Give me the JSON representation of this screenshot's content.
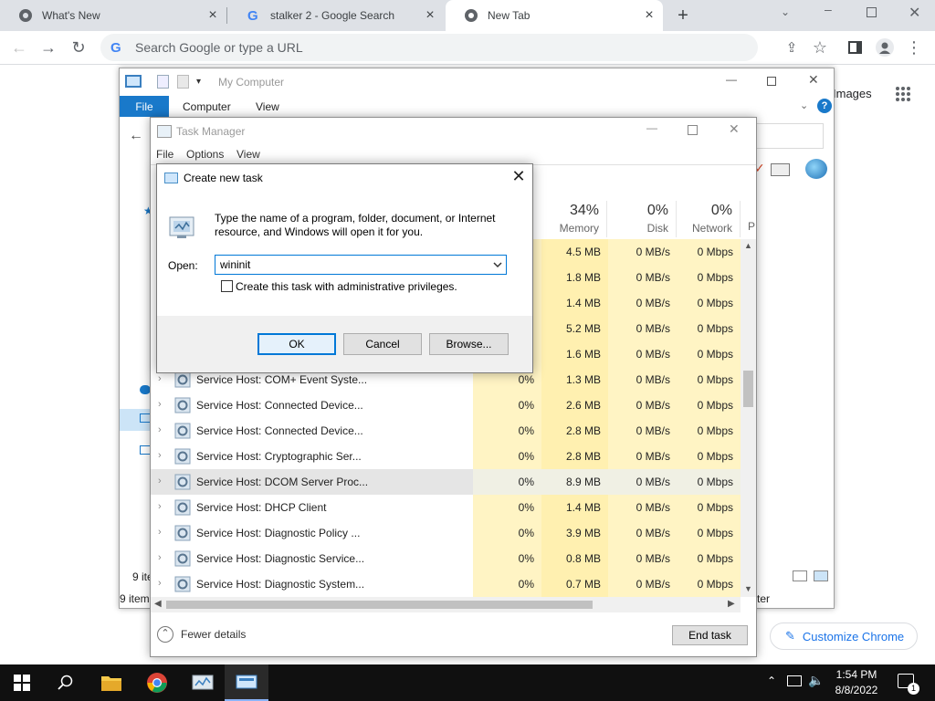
{
  "chrome": {
    "tabs": [
      {
        "title": "What's New"
      },
      {
        "title": "stalker 2 - Google Search"
      },
      {
        "title": "New Tab"
      }
    ],
    "omnibox_placeholder": "Search Google or type a URL",
    "ntp_images_link": "Images",
    "customize_label": "Customize Chrome"
  },
  "explorer": {
    "title": "My Computer",
    "ribbon": {
      "file": "File",
      "computer": "Computer",
      "view": "View"
    },
    "status_items_partial": "9 ite",
    "status_items": "9 item",
    "status_right": "ter"
  },
  "taskmgr": {
    "title": "Task Manager",
    "menu": {
      "file": "File",
      "options": "Options",
      "view": "View"
    },
    "columns": {
      "memory": {
        "pct": "34%",
        "label": "Memory"
      },
      "disk": {
        "pct": "0%",
        "label": "Disk"
      },
      "network": {
        "pct": "0%",
        "label": "Network"
      },
      "power_partial": "P"
    },
    "hidden_rows": [
      {
        "mem": "4.5 MB",
        "disk": "0 MB/s",
        "net": "0 Mbps"
      },
      {
        "mem": "1.8 MB",
        "disk": "0 MB/s",
        "net": "0 Mbps"
      },
      {
        "mem": "1.4 MB",
        "disk": "0 MB/s",
        "net": "0 Mbps"
      },
      {
        "mem": "5.2 MB",
        "disk": "0 MB/s",
        "net": "0 Mbps"
      },
      {
        "mem": "1.6 MB",
        "disk": "0 MB/s",
        "net": "0 Mbps"
      }
    ],
    "rows": [
      {
        "name": "Service Host: COM+ Event Syste...",
        "cpu": "0%",
        "mem": "1.3 MB",
        "disk": "0 MB/s",
        "net": "0 Mbps"
      },
      {
        "name": "Service Host: Connected Device...",
        "cpu": "0%",
        "mem": "2.6 MB",
        "disk": "0 MB/s",
        "net": "0 Mbps"
      },
      {
        "name": "Service Host: Connected Device...",
        "cpu": "0%",
        "mem": "2.8 MB",
        "disk": "0 MB/s",
        "net": "0 Mbps"
      },
      {
        "name": "Service Host: Cryptographic Ser...",
        "cpu": "0%",
        "mem": "2.8 MB",
        "disk": "0 MB/s",
        "net": "0 Mbps"
      },
      {
        "name": "Service Host: DCOM Server Proc...",
        "cpu": "0%",
        "mem": "8.9 MB",
        "disk": "0 MB/s",
        "net": "0 Mbps"
      },
      {
        "name": "Service Host: DHCP Client",
        "cpu": "0%",
        "mem": "1.4 MB",
        "disk": "0 MB/s",
        "net": "0 Mbps"
      },
      {
        "name": "Service Host: Diagnostic Policy ...",
        "cpu": "0%",
        "mem": "3.9 MB",
        "disk": "0 MB/s",
        "net": "0 Mbps"
      },
      {
        "name": "Service Host: Diagnostic Service...",
        "cpu": "0%",
        "mem": "0.8 MB",
        "disk": "0 MB/s",
        "net": "0 Mbps"
      },
      {
        "name": "Service Host: Diagnostic System...",
        "cpu": "0%",
        "mem": "0.7 MB",
        "disk": "0 MB/s",
        "net": "0 Mbps"
      }
    ],
    "fewer_details": "Fewer details",
    "end_task": "End task"
  },
  "dialog": {
    "title": "Create new task",
    "message": "Type the name of a program, folder, document, or Internet resource, and Windows will open it for you.",
    "open_label": "Open:",
    "input_value": "wininit",
    "admin_checkbox_label": "Create this task with administrative privileges.",
    "ok": "OK",
    "cancel": "Cancel",
    "browse": "Browse..."
  },
  "taskbar": {
    "time": "1:54 PM",
    "date": "8/8/2022",
    "notification_count": "1"
  }
}
